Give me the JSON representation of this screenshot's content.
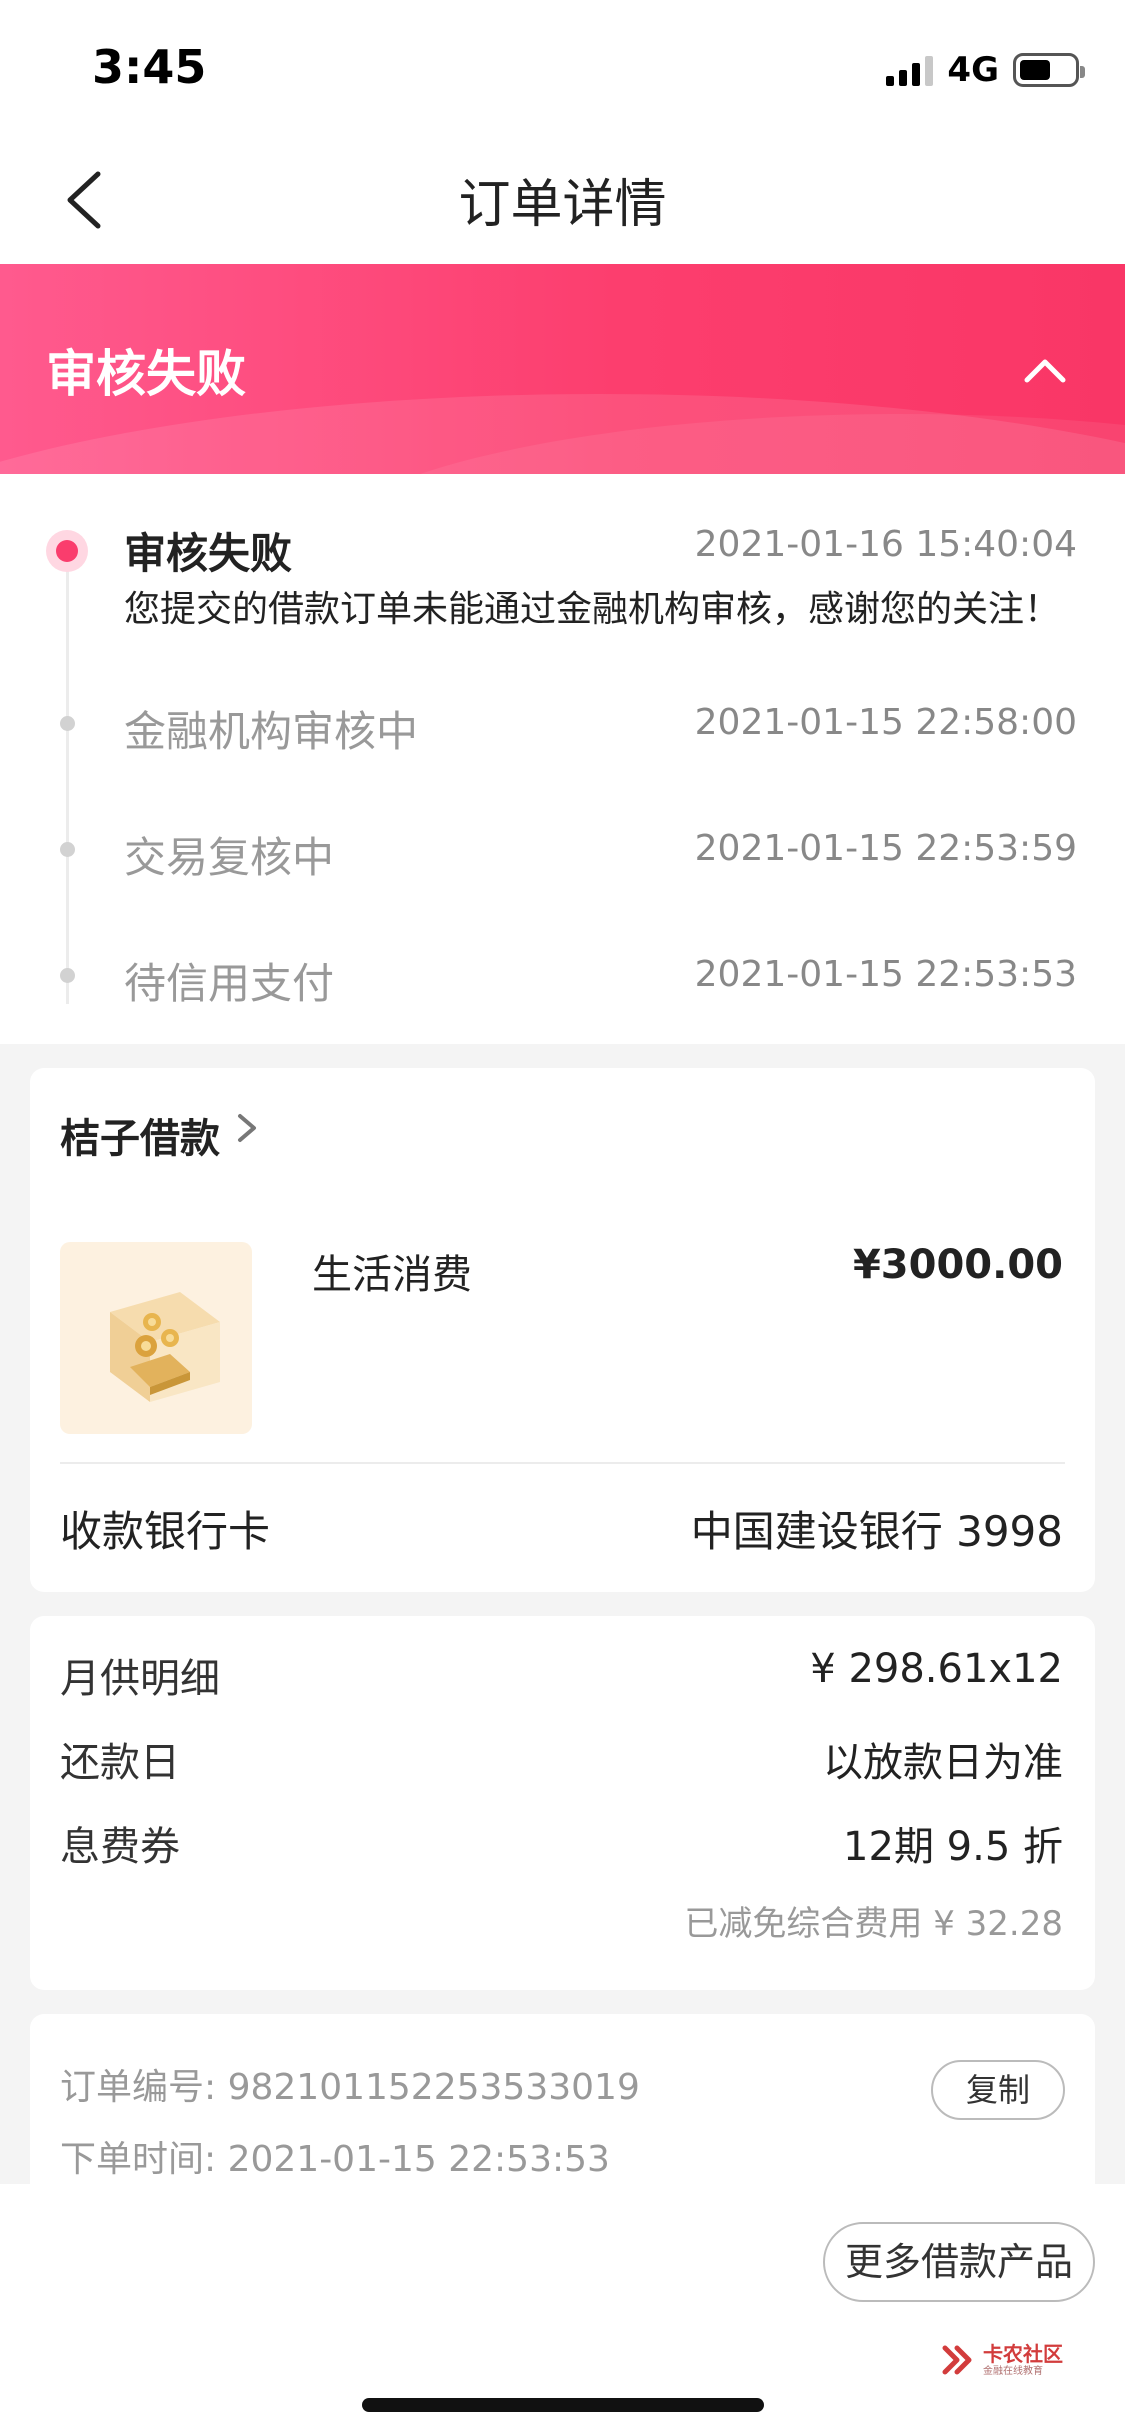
{
  "status_bar": {
    "time": "3:45",
    "network": "4G"
  },
  "header": {
    "title": "订单详情"
  },
  "banner": {
    "title": "审核失败"
  },
  "timeline": [
    {
      "status": "审核失败",
      "time": "2021-01-16 15:40:04",
      "description": "您提交的借款订单未能通过金融机构审核，感谢您的关注！"
    },
    {
      "status": "金融机构审核中",
      "time": "2021-01-15 22:58:00"
    },
    {
      "status": "交易复核中",
      "time": "2021-01-15 22:53:59"
    },
    {
      "status": "待信用支付",
      "time": "2021-01-15 22:53:53"
    }
  ],
  "loan": {
    "product": "桔子借款",
    "purpose": "生活消费",
    "amount": "¥3000.00",
    "bank_label": "收款银行卡",
    "bank_value": "中国建设银行 3998"
  },
  "repayment": {
    "monthly_label": "月供明细",
    "monthly_value": "¥ 298.61x12",
    "due_label": "还款日",
    "due_value": "以放款日为准",
    "coupon_label": "息费券",
    "coupon_value": "12期 9.5 折",
    "coupon_note": "已减免综合费用 ¥ 32.28"
  },
  "order": {
    "number_line": "订单编号: 982101152253533019",
    "time_line": "下单时间: 2021-01-15 22:53:53",
    "copy_label": "复制"
  },
  "footer": {
    "more_button": "更多借款产品",
    "watermark_name": "卡农社区",
    "watermark_sub": "金融在线教育"
  },
  "colors": {
    "accent": "#fa3d6d",
    "banner_start": "#ff5a8e",
    "banner_end": "#f93666"
  }
}
